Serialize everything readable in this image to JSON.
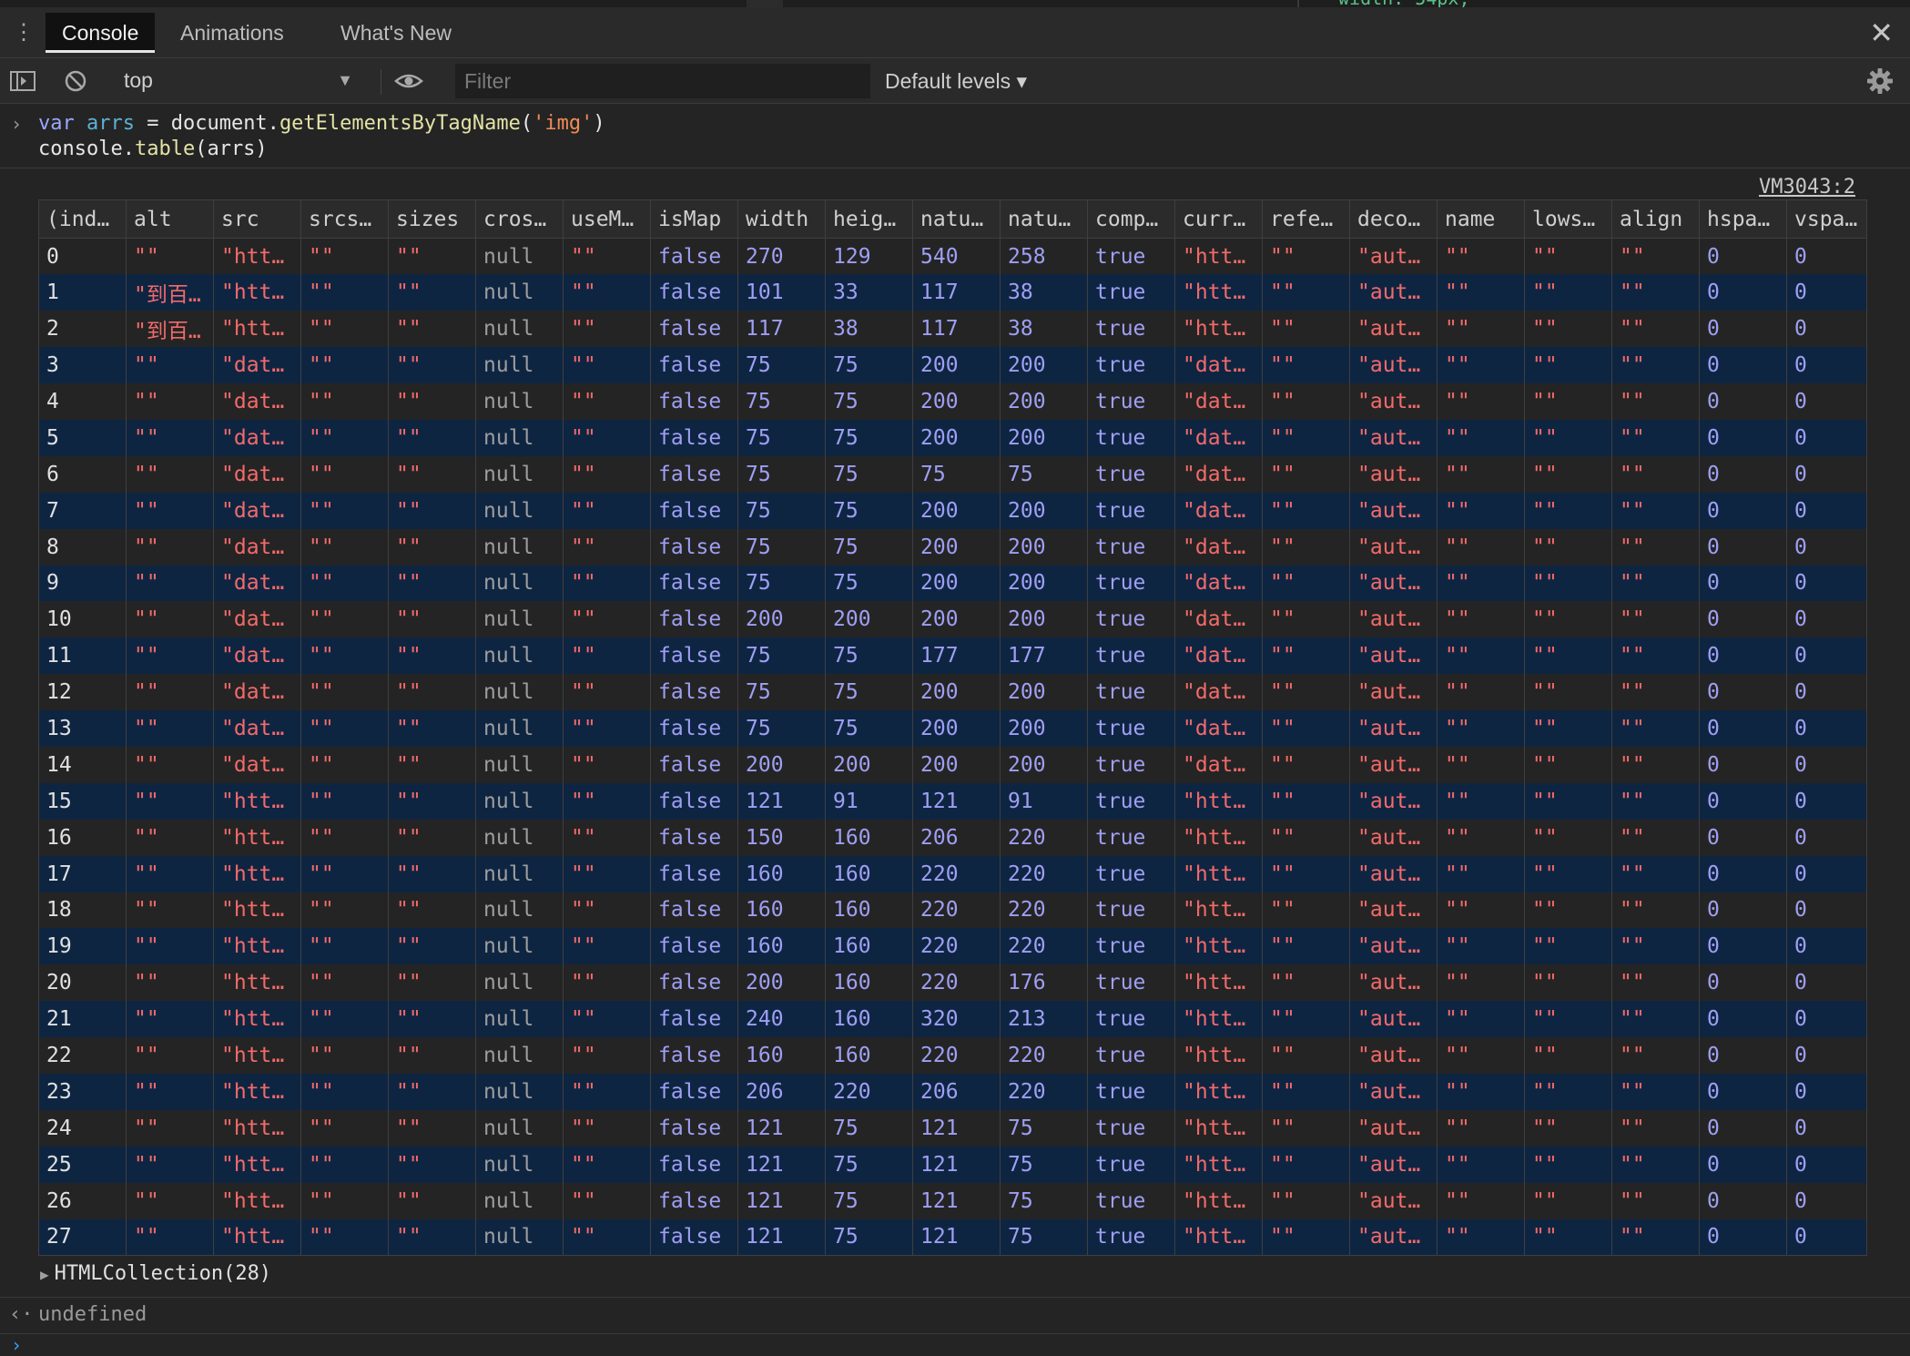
{
  "page_above": {
    "snippet": "width: 54px;"
  },
  "tabs": [
    {
      "label": "Console",
      "active": true
    },
    {
      "label": "Animations",
      "active": false
    },
    {
      "label": "What's New",
      "active": false
    }
  ],
  "icons": {
    "menu": "kebab-menu-icon",
    "close": "close-icon",
    "sidebar": "sidebar-toggle-icon",
    "clear": "clear-console-icon",
    "eye": "eye-icon",
    "settings": "gear-icon"
  },
  "toolbar": {
    "context": "top",
    "filter_placeholder": "Filter",
    "filter_value": "",
    "levels": "Default levels ▾"
  },
  "command": {
    "line1": {
      "kw": "var",
      "var": "arrs",
      "eq": " = document.",
      "fn": "getElementsByTagName",
      "open": "(",
      "str": "'img'",
      "close": ")"
    },
    "line2": {
      "obj": "console.",
      "fn": "table",
      "args": "(arrs)"
    }
  },
  "source_link": "VM3043:2",
  "table": {
    "columns": [
      "(ind…",
      "alt",
      "src",
      "srcs…",
      "sizes",
      "cros…",
      "useM…",
      "isMap",
      "width",
      "heig…",
      "natu…",
      "natu…",
      "comp…",
      "curr…",
      "refe…",
      "deco…",
      "name",
      "lows…",
      "align",
      "hspa…",
      "vspa…"
    ],
    "rows": [
      [
        "0",
        "\"\"",
        "\"htt…",
        "\"\"",
        "\"\"",
        "null",
        "\"\"",
        "false",
        "270",
        "129",
        "540",
        "258",
        "true",
        "\"htt…",
        "\"\"",
        "\"aut…",
        "\"\"",
        "\"\"",
        "\"\"",
        "0",
        "0"
      ],
      [
        "1",
        "\"到百…",
        "\"htt…",
        "\"\"",
        "\"\"",
        "null",
        "\"\"",
        "false",
        "101",
        "33",
        "117",
        "38",
        "true",
        "\"htt…",
        "\"\"",
        "\"aut…",
        "\"\"",
        "\"\"",
        "\"\"",
        "0",
        "0"
      ],
      [
        "2",
        "\"到百…",
        "\"htt…",
        "\"\"",
        "\"\"",
        "null",
        "\"\"",
        "false",
        "117",
        "38",
        "117",
        "38",
        "true",
        "\"htt…",
        "\"\"",
        "\"aut…",
        "\"\"",
        "\"\"",
        "\"\"",
        "0",
        "0"
      ],
      [
        "3",
        "\"\"",
        "\"dat…",
        "\"\"",
        "\"\"",
        "null",
        "\"\"",
        "false",
        "75",
        "75",
        "200",
        "200",
        "true",
        "\"dat…",
        "\"\"",
        "\"aut…",
        "\"\"",
        "\"\"",
        "\"\"",
        "0",
        "0"
      ],
      [
        "4",
        "\"\"",
        "\"dat…",
        "\"\"",
        "\"\"",
        "null",
        "\"\"",
        "false",
        "75",
        "75",
        "200",
        "200",
        "true",
        "\"dat…",
        "\"\"",
        "\"aut…",
        "\"\"",
        "\"\"",
        "\"\"",
        "0",
        "0"
      ],
      [
        "5",
        "\"\"",
        "\"dat…",
        "\"\"",
        "\"\"",
        "null",
        "\"\"",
        "false",
        "75",
        "75",
        "200",
        "200",
        "true",
        "\"dat…",
        "\"\"",
        "\"aut…",
        "\"\"",
        "\"\"",
        "\"\"",
        "0",
        "0"
      ],
      [
        "6",
        "\"\"",
        "\"dat…",
        "\"\"",
        "\"\"",
        "null",
        "\"\"",
        "false",
        "75",
        "75",
        "75",
        "75",
        "true",
        "\"dat…",
        "\"\"",
        "\"aut…",
        "\"\"",
        "\"\"",
        "\"\"",
        "0",
        "0"
      ],
      [
        "7",
        "\"\"",
        "\"dat…",
        "\"\"",
        "\"\"",
        "null",
        "\"\"",
        "false",
        "75",
        "75",
        "200",
        "200",
        "true",
        "\"dat…",
        "\"\"",
        "\"aut…",
        "\"\"",
        "\"\"",
        "\"\"",
        "0",
        "0"
      ],
      [
        "8",
        "\"\"",
        "\"dat…",
        "\"\"",
        "\"\"",
        "null",
        "\"\"",
        "false",
        "75",
        "75",
        "200",
        "200",
        "true",
        "\"dat…",
        "\"\"",
        "\"aut…",
        "\"\"",
        "\"\"",
        "\"\"",
        "0",
        "0"
      ],
      [
        "9",
        "\"\"",
        "\"dat…",
        "\"\"",
        "\"\"",
        "null",
        "\"\"",
        "false",
        "75",
        "75",
        "200",
        "200",
        "true",
        "\"dat…",
        "\"\"",
        "\"aut…",
        "\"\"",
        "\"\"",
        "\"\"",
        "0",
        "0"
      ],
      [
        "10",
        "\"\"",
        "\"dat…",
        "\"\"",
        "\"\"",
        "null",
        "\"\"",
        "false",
        "200",
        "200",
        "200",
        "200",
        "true",
        "\"dat…",
        "\"\"",
        "\"aut…",
        "\"\"",
        "\"\"",
        "\"\"",
        "0",
        "0"
      ],
      [
        "11",
        "\"\"",
        "\"dat…",
        "\"\"",
        "\"\"",
        "null",
        "\"\"",
        "false",
        "75",
        "75",
        "177",
        "177",
        "true",
        "\"dat…",
        "\"\"",
        "\"aut…",
        "\"\"",
        "\"\"",
        "\"\"",
        "0",
        "0"
      ],
      [
        "12",
        "\"\"",
        "\"dat…",
        "\"\"",
        "\"\"",
        "null",
        "\"\"",
        "false",
        "75",
        "75",
        "200",
        "200",
        "true",
        "\"dat…",
        "\"\"",
        "\"aut…",
        "\"\"",
        "\"\"",
        "\"\"",
        "0",
        "0"
      ],
      [
        "13",
        "\"\"",
        "\"dat…",
        "\"\"",
        "\"\"",
        "null",
        "\"\"",
        "false",
        "75",
        "75",
        "200",
        "200",
        "true",
        "\"dat…",
        "\"\"",
        "\"aut…",
        "\"\"",
        "\"\"",
        "\"\"",
        "0",
        "0"
      ],
      [
        "14",
        "\"\"",
        "\"dat…",
        "\"\"",
        "\"\"",
        "null",
        "\"\"",
        "false",
        "200",
        "200",
        "200",
        "200",
        "true",
        "\"dat…",
        "\"\"",
        "\"aut…",
        "\"\"",
        "\"\"",
        "\"\"",
        "0",
        "0"
      ],
      [
        "15",
        "\"\"",
        "\"htt…",
        "\"\"",
        "\"\"",
        "null",
        "\"\"",
        "false",
        "121",
        "91",
        "121",
        "91",
        "true",
        "\"htt…",
        "\"\"",
        "\"aut…",
        "\"\"",
        "\"\"",
        "\"\"",
        "0",
        "0"
      ],
      [
        "16",
        "\"\"",
        "\"htt…",
        "\"\"",
        "\"\"",
        "null",
        "\"\"",
        "false",
        "150",
        "160",
        "206",
        "220",
        "true",
        "\"htt…",
        "\"\"",
        "\"aut…",
        "\"\"",
        "\"\"",
        "\"\"",
        "0",
        "0"
      ],
      [
        "17",
        "\"\"",
        "\"htt…",
        "\"\"",
        "\"\"",
        "null",
        "\"\"",
        "false",
        "160",
        "160",
        "220",
        "220",
        "true",
        "\"htt…",
        "\"\"",
        "\"aut…",
        "\"\"",
        "\"\"",
        "\"\"",
        "0",
        "0"
      ],
      [
        "18",
        "\"\"",
        "\"htt…",
        "\"\"",
        "\"\"",
        "null",
        "\"\"",
        "false",
        "160",
        "160",
        "220",
        "220",
        "true",
        "\"htt…",
        "\"\"",
        "\"aut…",
        "\"\"",
        "\"\"",
        "\"\"",
        "0",
        "0"
      ],
      [
        "19",
        "\"\"",
        "\"htt…",
        "\"\"",
        "\"\"",
        "null",
        "\"\"",
        "false",
        "160",
        "160",
        "220",
        "220",
        "true",
        "\"htt…",
        "\"\"",
        "\"aut…",
        "\"\"",
        "\"\"",
        "\"\"",
        "0",
        "0"
      ],
      [
        "20",
        "\"\"",
        "\"htt…",
        "\"\"",
        "\"\"",
        "null",
        "\"\"",
        "false",
        "200",
        "160",
        "220",
        "176",
        "true",
        "\"htt…",
        "\"\"",
        "\"aut…",
        "\"\"",
        "\"\"",
        "\"\"",
        "0",
        "0"
      ],
      [
        "21",
        "\"\"",
        "\"htt…",
        "\"\"",
        "\"\"",
        "null",
        "\"\"",
        "false",
        "240",
        "160",
        "320",
        "213",
        "true",
        "\"htt…",
        "\"\"",
        "\"aut…",
        "\"\"",
        "\"\"",
        "\"\"",
        "0",
        "0"
      ],
      [
        "22",
        "\"\"",
        "\"htt…",
        "\"\"",
        "\"\"",
        "null",
        "\"\"",
        "false",
        "160",
        "160",
        "220",
        "220",
        "true",
        "\"htt…",
        "\"\"",
        "\"aut…",
        "\"\"",
        "\"\"",
        "\"\"",
        "0",
        "0"
      ],
      [
        "23",
        "\"\"",
        "\"htt…",
        "\"\"",
        "\"\"",
        "null",
        "\"\"",
        "false",
        "206",
        "220",
        "206",
        "220",
        "true",
        "\"htt…",
        "\"\"",
        "\"aut…",
        "\"\"",
        "\"\"",
        "\"\"",
        "0",
        "0"
      ],
      [
        "24",
        "\"\"",
        "\"htt…",
        "\"\"",
        "\"\"",
        "null",
        "\"\"",
        "false",
        "121",
        "75",
        "121",
        "75",
        "true",
        "\"htt…",
        "\"\"",
        "\"aut…",
        "\"\"",
        "\"\"",
        "\"\"",
        "0",
        "0"
      ],
      [
        "25",
        "\"\"",
        "\"htt…",
        "\"\"",
        "\"\"",
        "null",
        "\"\"",
        "false",
        "121",
        "75",
        "121",
        "75",
        "true",
        "\"htt…",
        "\"\"",
        "\"aut…",
        "\"\"",
        "\"\"",
        "\"\"",
        "0",
        "0"
      ],
      [
        "26",
        "\"\"",
        "\"htt…",
        "\"\"",
        "\"\"",
        "null",
        "\"\"",
        "false",
        "121",
        "75",
        "121",
        "75",
        "true",
        "\"htt…",
        "\"\"",
        "\"aut…",
        "\"\"",
        "\"\"",
        "\"\"",
        "0",
        "0"
      ],
      [
        "27",
        "\"\"",
        "\"htt…",
        "\"\"",
        "\"\"",
        "null",
        "\"\"",
        "false",
        "121",
        "75",
        "121",
        "75",
        "true",
        "\"htt…",
        "\"\"",
        "\"aut…",
        "\"\"",
        "\"\"",
        "\"\"",
        "0",
        "0"
      ]
    ]
  },
  "collection_label": "HTMLCollection(28)",
  "result_value": "undefined",
  "colors": {
    "background": "#242424",
    "row_alt": "#0e2542",
    "string": "#f36a6a",
    "number": "#9f9ff5",
    "accent": "#3f9ff5"
  }
}
